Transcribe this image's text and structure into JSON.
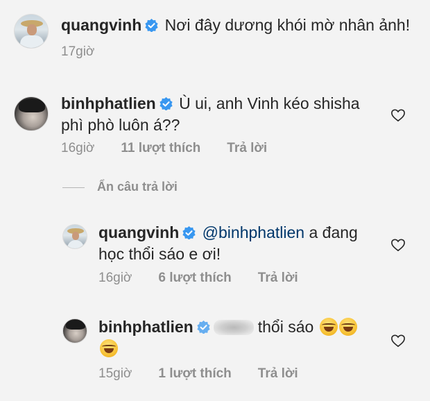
{
  "post": {
    "username": "quangvinh",
    "caption": "Nơi đây dương khói mờ nhân ảnh!",
    "time": "17giờ"
  },
  "comments": [
    {
      "username": "binhphatlien",
      "text_line1": "Ù ui, anh Vinh kéo shisha",
      "text_line2": "phì phò luôn á??",
      "time": "16giờ",
      "likes": "11 lượt thích",
      "reply": "Trả lời"
    }
  ],
  "hide_replies": "Ẩn câu trả lời",
  "replies": [
    {
      "username": "quangvinh",
      "mention": "@binhphatlien",
      "text_line1": "a đang",
      "text_line2": "học thổi sáo e ơi!",
      "time": "16giờ",
      "likes": "6 lượt thích",
      "reply": "Trả lời"
    },
    {
      "username": "binhphatlien",
      "text": "thổi sáo",
      "time": "15giờ",
      "likes": "1 lượt thích",
      "reply": "Trả lời"
    }
  ],
  "icons": {
    "verified_color": "#3897f0",
    "heart": "heart-outline-icon",
    "emoji": "face-with-tears-of-joy"
  }
}
